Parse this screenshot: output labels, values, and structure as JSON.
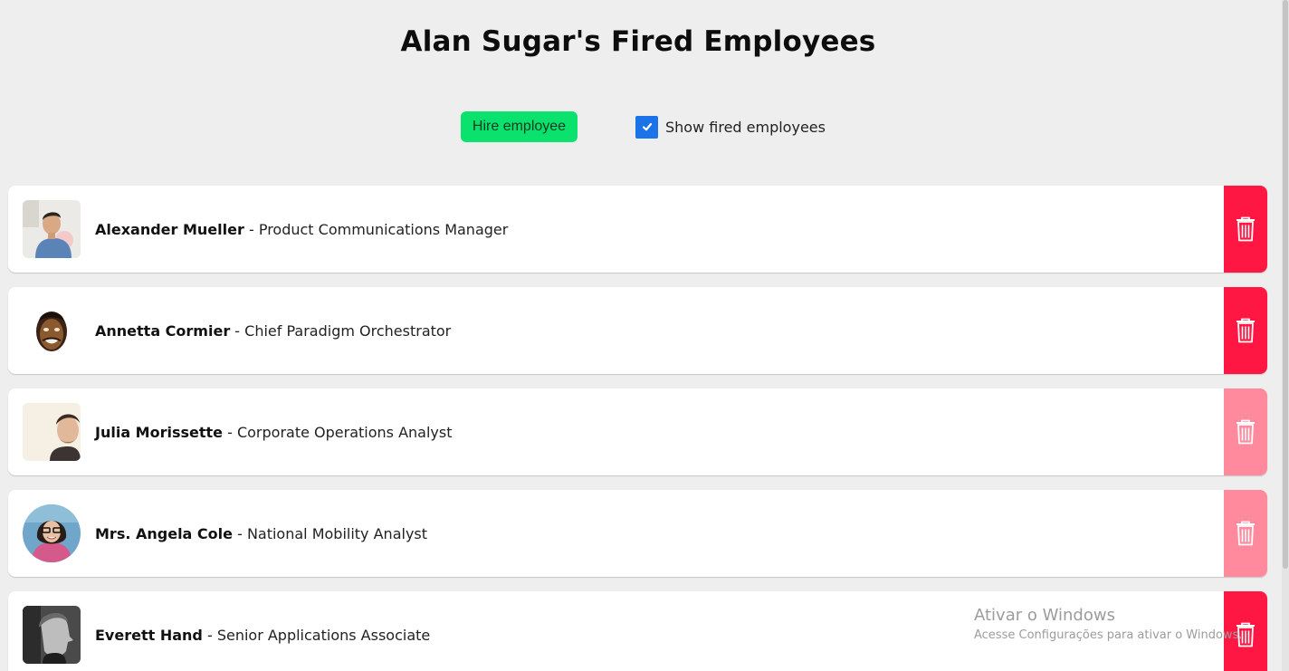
{
  "header": {
    "title": "Alan Sugar's Fired Employees"
  },
  "controls": {
    "hire_label": "Hire employee",
    "show_fired_label": "Show fired employees",
    "show_fired_checked": true
  },
  "colors": {
    "hire_button": "#0be26d",
    "delete_active": "#ff1744",
    "delete_fired": "#ff8a9d",
    "checkbox": "#1a73e8"
  },
  "employees": [
    {
      "name": "Alexander Mueller",
      "separator": " - ",
      "title": "Product Communications Manager",
      "fired": false,
      "avatar_icon": "man-photo"
    },
    {
      "name": "Annetta Cormier",
      "separator": " - ",
      "title": "Chief Paradigm Orchestrator",
      "fired": false,
      "avatar_icon": "cartoon-face"
    },
    {
      "name": "Julia Morissette",
      "separator": " - ",
      "title": "Corporate Operations Analyst",
      "fired": true,
      "avatar_icon": "man-photo"
    },
    {
      "name": "Mrs. Angela Cole",
      "separator": " - ",
      "title": "National Mobility Analyst",
      "fired": true,
      "avatar_icon": "woman-photo"
    },
    {
      "name": "Everett Hand",
      "separator": " - ",
      "title": "Senior Applications Associate",
      "fired": false,
      "avatar_icon": "man-profile-photo"
    }
  ],
  "watermark": {
    "title": "Ativar o Windows",
    "subtitle": "Acesse Configurações para ativar o Windows."
  }
}
